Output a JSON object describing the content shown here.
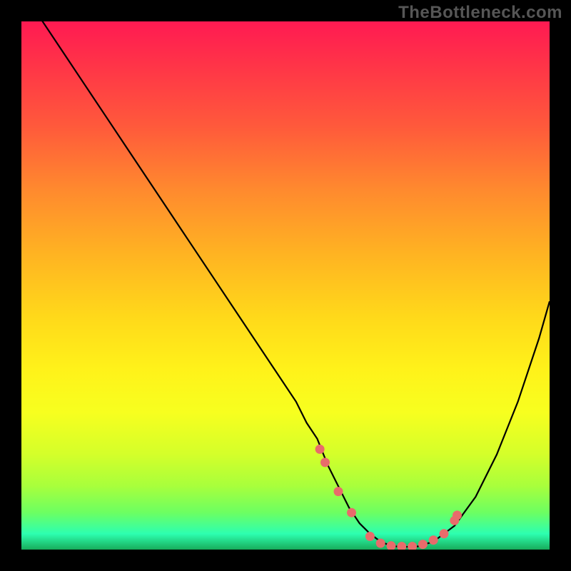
{
  "watermark": "TheBottleneck.com",
  "chart_data": {
    "type": "line",
    "title": "",
    "xlabel": "",
    "ylabel": "",
    "xlim": [
      0,
      100
    ],
    "ylim": [
      0,
      100
    ],
    "series": [
      {
        "name": "curve",
        "x": [
          0,
          4,
          8,
          12,
          16,
          20,
          24,
          28,
          32,
          36,
          40,
          44,
          48,
          52,
          54,
          56,
          58,
          60,
          62,
          64,
          66,
          68,
          70,
          72,
          75,
          78,
          82,
          86,
          90,
          94,
          98,
          100
        ],
        "values": [
          110,
          100,
          94,
          88,
          82,
          76,
          70,
          64,
          58,
          52,
          46,
          40,
          34,
          28,
          24,
          21,
          16,
          12,
          8,
          5,
          3,
          1.5,
          0.7,
          0.5,
          0.6,
          1.5,
          4.5,
          10,
          18,
          28,
          40,
          47
        ]
      }
    ],
    "markers": {
      "name": "dots",
      "x": [
        56.5,
        57.5,
        60,
        62.5,
        66,
        68,
        70,
        72,
        74,
        76,
        78,
        80,
        82,
        82.5
      ],
      "values": [
        19,
        16.5,
        11,
        7,
        2.5,
        1.2,
        0.7,
        0.6,
        0.6,
        1,
        1.8,
        3,
        5.5,
        6.5
      ]
    },
    "gradient_stops": [
      {
        "pos": 0,
        "color": "#ff1a52"
      },
      {
        "pos": 8,
        "color": "#ff3348"
      },
      {
        "pos": 20,
        "color": "#ff5a3b"
      },
      {
        "pos": 32,
        "color": "#ff8a2e"
      },
      {
        "pos": 44,
        "color": "#ffb322"
      },
      {
        "pos": 56,
        "color": "#ffd91a"
      },
      {
        "pos": 66,
        "color": "#fff21a"
      },
      {
        "pos": 74,
        "color": "#f7ff1f"
      },
      {
        "pos": 82,
        "color": "#d4ff2a"
      },
      {
        "pos": 88,
        "color": "#a8ff3c"
      },
      {
        "pos": 93,
        "color": "#6cff62"
      },
      {
        "pos": 97,
        "color": "#2dffb0"
      },
      {
        "pos": 100,
        "color": "#18ac5b"
      }
    ],
    "marker_color": "#e86b6b",
    "curve_color": "#000000"
  }
}
